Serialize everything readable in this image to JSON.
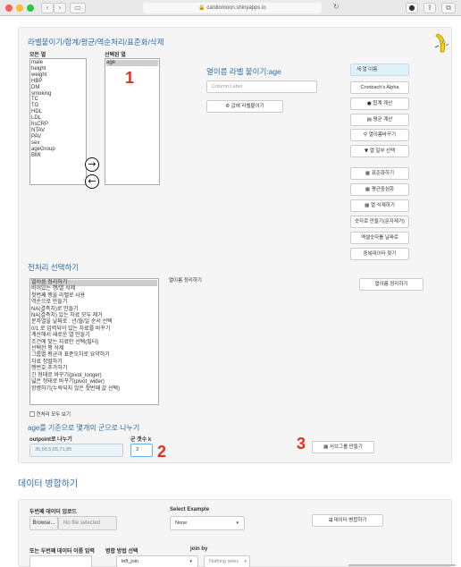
{
  "browser": {
    "url": "cardiomoon.shinyapps.io"
  },
  "top": {
    "heading": "라벨붙이기/합계/평균/역순처리/표준화/삭제",
    "all_columns_label": "모든 열",
    "all_columns": [
      "male",
      "height",
      "weight",
      "HBP",
      "DM",
      "smoking",
      "TC",
      "TG",
      "HDL",
      "LDL",
      "hsCRP",
      "NTAV",
      "PAV",
      "sex",
      "ageGroup",
      "BMI"
    ],
    "selected_label": "선택된 열",
    "selected": [
      "age"
    ],
    "label_heading": "열이름 라벨 붙이기:age",
    "label_placeholder": "Column Label",
    "label_button": "값에 라벨붙이기",
    "side_buttons": [
      "새 열 이름",
      "Cronbach's Alpha",
      "합계 계산",
      "평균 계산",
      "열이름바꾸기",
      "열 일부 선택",
      "표준화하기",
      "평균중심화",
      "열 삭제하기",
      "숫자로 만들기(문자제거)",
      "엑셀숫자를 날짜로",
      "중복데이타 찾기"
    ]
  },
  "pre": {
    "heading": "전처리 선택하기",
    "options": [
      "열이름 정리하기",
      "비어있는 행/열 삭제",
      "첫번째 행을 라벨로 사용",
      "역순으로 만들기",
      "NA(결측치)로 만들기",
      "NA(결측치) 있는 자료 모두 제거",
      "문자열을 날짜로 : 년/월/일 순서 선택",
      "0/1 로 입력되어 있는 자료를 바꾸기",
      "계산해서 새로운 열 만들기",
      "조건에 맞는 자료만 선택(필터)",
      "선택한 행 삭제",
      "그룹별 평균과 표준오차로 요약하기",
      "자료 정렬하기",
      "행번호 추가하기",
      "긴 형태로 바꾸기(pivot_longer)",
      "넓은 형태로 바꾸기(pivot_wider)",
      "항병하기(누락되지 않은 첫번째 값 선택)"
    ],
    "selected_title": "열이름 정리하기",
    "action_button": "열이름 정리하기",
    "show_all": "전처리 모두 보기"
  },
  "group": {
    "heading": "age를 기준으로 몇개의 군으로 나누기",
    "outpoint_label": "outpoint로 나누기",
    "outpoint_value": "35,56.5,65,71,85",
    "k_label": "군 갯수 k",
    "k_value": "3",
    "button": "서브그룹 만들기"
  },
  "merge": {
    "heading": "데이터 병합하기",
    "upload_label": "두번째 데이터 업로드",
    "browse": "Browse...",
    "no_file": "No file selected",
    "example_label": "Select Example",
    "example_value": "None",
    "merge_button": "데이터 병합하기",
    "name_label": "또는 두번째 데이터 이름 입력",
    "method_label": "병합 방법 선택",
    "method_value": "left_join",
    "joinby_label": "join by",
    "joinby_value": "Nothing selec"
  },
  "markers": [
    "1",
    "2",
    "3"
  ],
  "colors": {
    "heading_blue": "#2e6da4",
    "marker_red": "#e0301e",
    "highlight": "#dff1f8"
  }
}
